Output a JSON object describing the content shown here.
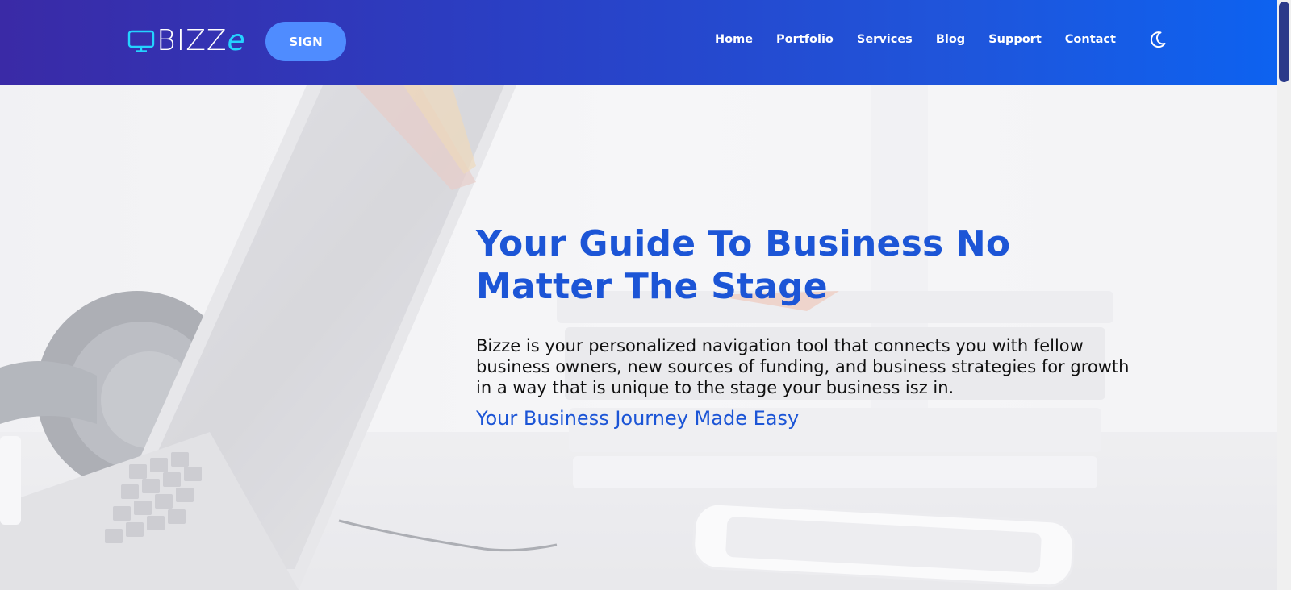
{
  "header": {
    "logo": {
      "text_main": "BIZZ",
      "text_accent": "e"
    },
    "sign_label": "SIGN",
    "nav": [
      {
        "label": "Home"
      },
      {
        "label": "Portfolio"
      },
      {
        "label": "Services"
      },
      {
        "label": "Blog"
      },
      {
        "label": "Support"
      },
      {
        "label": "Contact"
      }
    ],
    "theme_icon": "moon-icon"
  },
  "hero": {
    "title": "Your Guide To Business No Matter The Stage",
    "description": "Bizze is your personalized navigation tool that connects you with fellow business owners, new sources of funding, and business strategies for growth in a way that is unique to the stage your business isz in.",
    "tagline": "Your Business Journey Made Easy"
  },
  "colors": {
    "header_gradient_start": "#3a2aa6",
    "header_gradient_end": "#0d62f0",
    "sign_button": "#4f8cff",
    "logo_accent": "#24d3ff",
    "title_blue": "#1c55d6",
    "body_text": "#111111"
  }
}
